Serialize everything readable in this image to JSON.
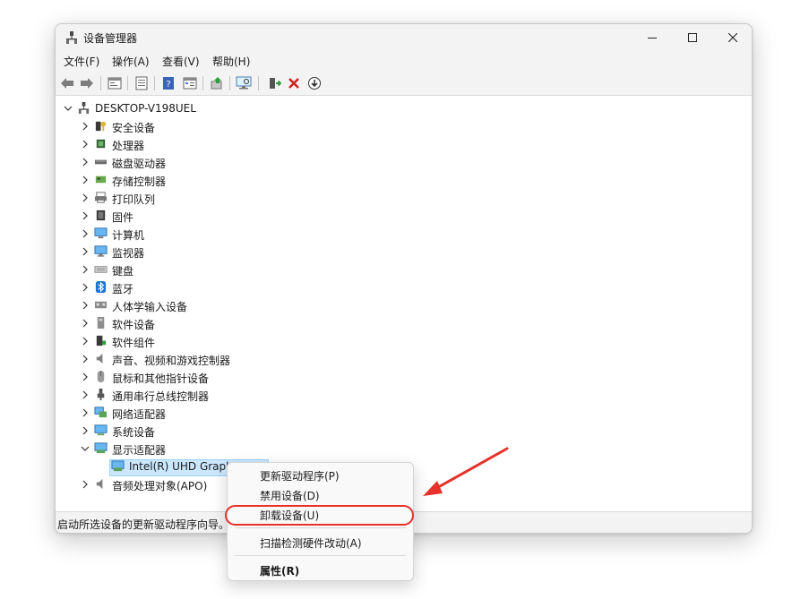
{
  "window": {
    "title": "设备管理器",
    "controls": {
      "minimize": "minimize",
      "maximize": "maximize",
      "close": "close"
    }
  },
  "menu": {
    "items": [
      "文件(F)",
      "操作(A)",
      "查看(V)",
      "帮助(H)"
    ]
  },
  "toolbar": {
    "buttons": [
      "back-icon",
      "forward-icon",
      "properties-icon",
      "show-hide-icon",
      "help-icon",
      "view-icon",
      "update-driver-icon",
      "scan-icon",
      "enable-icon",
      "uninstall-icon",
      "download-icon"
    ]
  },
  "tree": {
    "root": "DESKTOP-V198UEL",
    "categories": [
      "安全设备",
      "处理器",
      "磁盘驱动器",
      "存储控制器",
      "打印队列",
      "固件",
      "计算机",
      "监视器",
      "键盘",
      "蓝牙",
      "人体学输入设备",
      "软件设备",
      "软件组件",
      "声音、视频和游戏控制器",
      "鼠标和其他指针设备",
      "通用串行总线控制器",
      "网络适配器",
      "系统设备",
      "显示适配器",
      "音频处理对象(APO)"
    ],
    "expanded_child": "Intel(R) UHD Graph"
  },
  "status": {
    "text": "启动所选设备的更新驱动程序向导。"
  },
  "context_menu": {
    "update_driver": "更新驱动程序(P)",
    "disable": "禁用设备(D)",
    "uninstall": "卸载设备(U)",
    "scan": "扫描检测硬件改动(A)",
    "properties": "属性(R)"
  },
  "colors": {
    "accent": "#0078d4",
    "highlight": "#e6322a",
    "selection": "#cce8ff"
  }
}
